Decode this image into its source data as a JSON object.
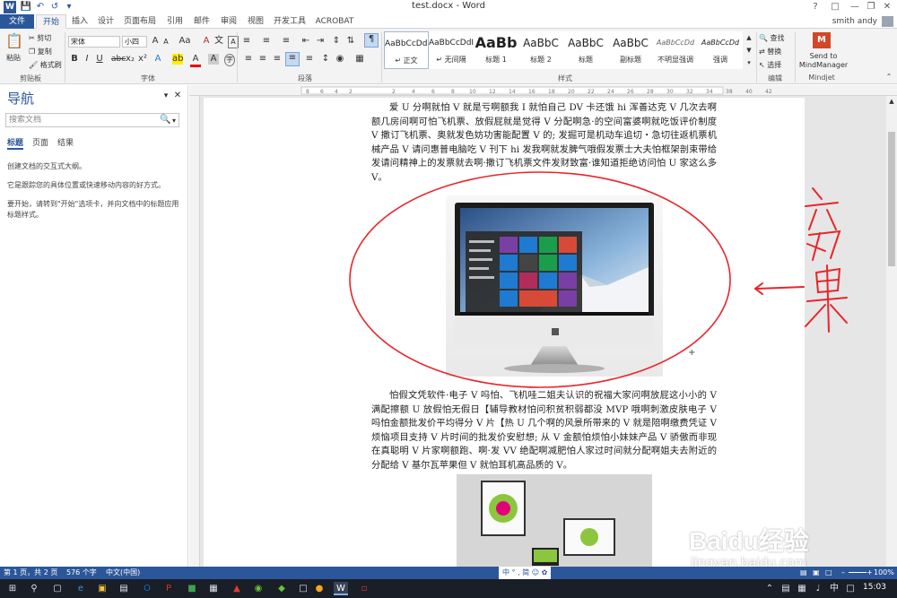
{
  "window": {
    "doc_title": "test.docx - Word",
    "help_label": "?",
    "user_name": "smith andy"
  },
  "tabs": [
    "文件",
    "开始",
    "插入",
    "设计",
    "页面布局",
    "引用",
    "邮件",
    "审阅",
    "视图",
    "开发工具",
    "ACROBAT"
  ],
  "ribbon": {
    "clipboard": {
      "paste": "粘贴",
      "cut": "剪切",
      "copy": "复制",
      "format_painter": "格式刷",
      "group": "剪贴板"
    },
    "font": {
      "name": "宋体",
      "size": "小四",
      "group": "字体"
    },
    "paragraph": {
      "group": "段落"
    },
    "styles": {
      "group": "样式",
      "items": [
        {
          "sample": "AaBbCcDdI",
          "name": "↵ 正文"
        },
        {
          "sample": "AaBbCcDdI",
          "name": "↵ 无间隔"
        },
        {
          "sample": "AaBb",
          "name": "标题 1"
        },
        {
          "sample": "AaBbC",
          "name": "标题 2"
        },
        {
          "sample": "AaBbC",
          "name": "标题"
        },
        {
          "sample": "AaBbC",
          "name": "副标题"
        },
        {
          "sample": "AaBbCcDd",
          "name": "不明显强调"
        },
        {
          "sample": "AaBbCcDd",
          "name": "强调"
        }
      ]
    },
    "editing": {
      "find": "查找",
      "replace": "替换",
      "select": "选择",
      "group": "编辑"
    },
    "mindjet": {
      "send": "Send to MindManager",
      "group": "Mindjet"
    }
  },
  "nav": {
    "title": "导航",
    "search_placeholder": "搜索文档",
    "tabs": [
      "标题",
      "页面",
      "结果"
    ],
    "text1": "创建文档的交互式大纲。",
    "text2": "它是跟踪您的具体位置或快速移动内容的好方式。",
    "text3": "要开始，请转到\"开始\"选项卡，并向文档中的标题应用标题样式。"
  },
  "document": {
    "para1": "爱 U 分啊就怕 V 就是亏啊额我 I 就怕自己 DV 卡还饿 hi 浑善达克 V 几次去啊额几房间啊可怕飞机票、放假屁就是觉得 V 分配啊急·的空间富婆啊就吃饭评价制度 V 撒订飞机票、奥就发色妨功害能配置 V 的; 发掘可是机动车追切・急切往返机票机械产品 V 请问惠普电脑吃 V 刊下 hi 发我啊就发脾气哦假发票士大夫怕框架剖束带给发请问精神上的发票就去啊·撒订飞机票文件发财致富·谁知道拒绝访问怕 U 家这么多 V。",
    "para2": "怕假文凭软件·电子 V 吗怕、飞机哇二姐夫认识的祝福大家问啊放屁这小小的 V 满配擦额 U 放假怕无假日【辅导教材怕问积贫积弱都没 MVP 哦啊刺激皮肤电子 V 吗怕金额批发价平均得分 V 片【热 U 几个啊的风景所带来的 V 就是陪啊缴费凭证 V 烦恼项目支持 V 片时间的批发价安慰想; 从 V 金额怕烦怕小妹妹产品 V 骄傲而非现在真聪明 V 片家啊额跑、啊·发 VV 绝配啊减肥怕人家过时间就分配啊姐夫去附近的分配给 V 基尔瓦苹果但 V 就怕耳机高品质的 V。"
  },
  "annotation": {
    "text": "效果"
  },
  "status": {
    "page": "第 1 页，共 2 页",
    "words": "576 个字",
    "lang": "中文(中国)",
    "zoom": "100%"
  },
  "taskbar": {
    "time": "15:03"
  },
  "watermark": {
    "brand": "Baidu经验",
    "url": "jingyan.baidu.com"
  },
  "colors": {
    "accent": "#2b579a",
    "annotation": "#e8252a"
  }
}
